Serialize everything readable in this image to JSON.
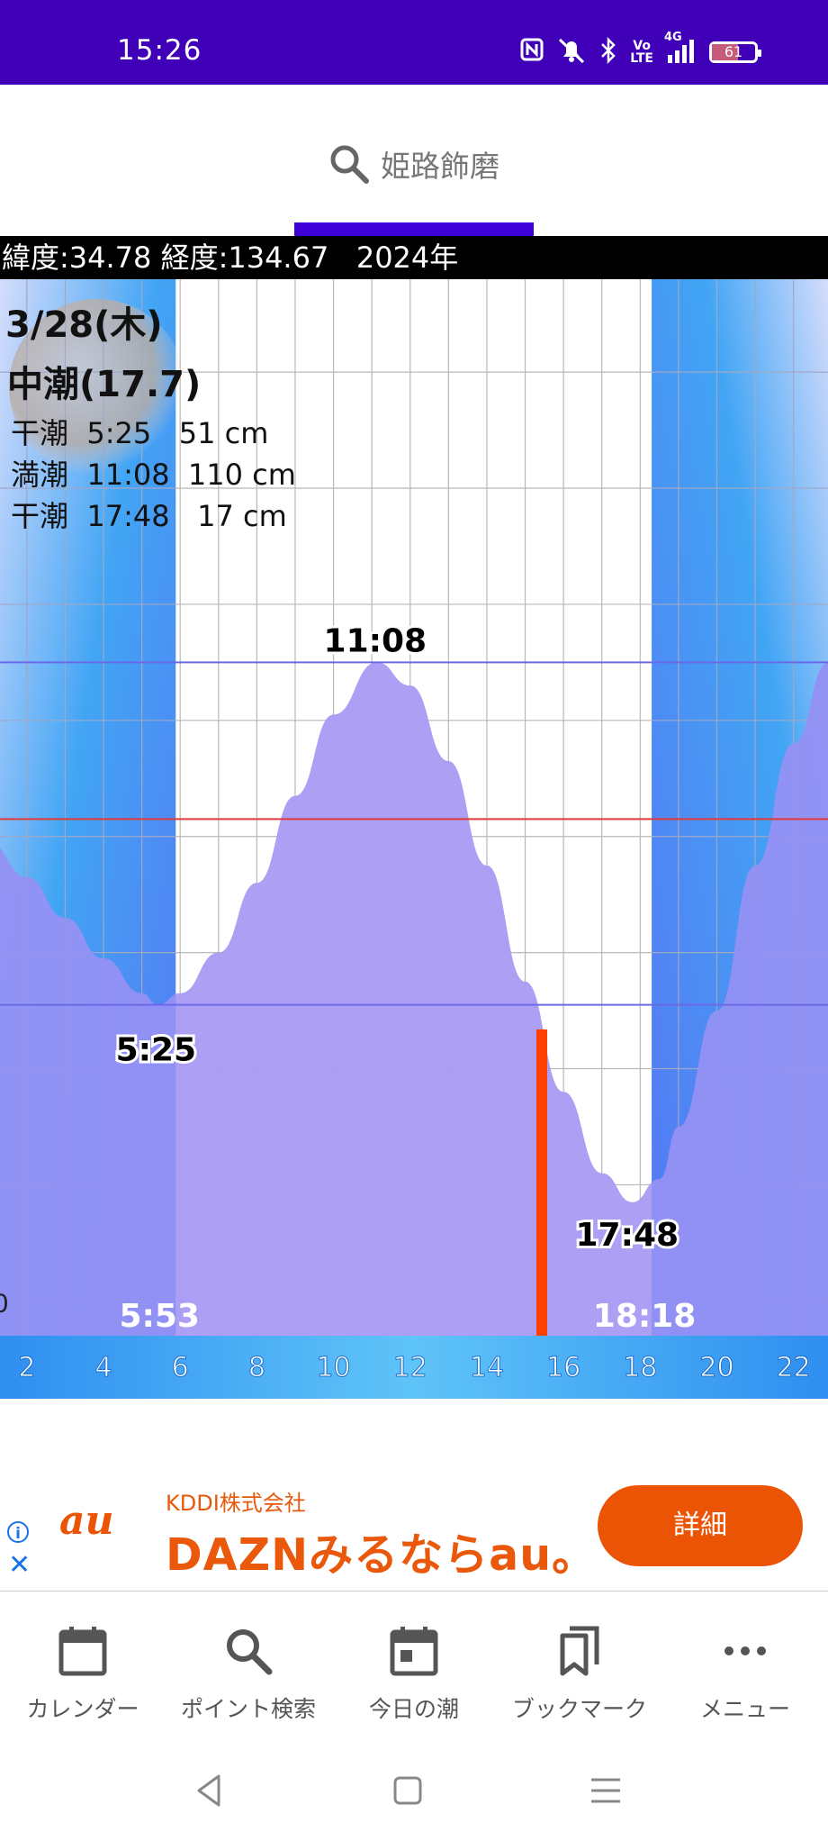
{
  "status_bar": {
    "time": "15:26",
    "icons": [
      "nfc-icon",
      "mute-icon",
      "bluetooth-icon",
      "volte-icon",
      "signal-icon"
    ],
    "volte_label": "Vo\nLTE",
    "network_label": "4G",
    "battery_level": "61",
    "background_color": "#4000b8"
  },
  "search": {
    "location": "姫路飾磨",
    "tab_indicator_color": "#4000d8"
  },
  "info_strip": {
    "text": "緯度:34.78 経度:134.67   2024年"
  },
  "chart_data": {
    "type": "area",
    "date": "3/28(木)",
    "tide_name": "中潮(17.7)",
    "tide_events": [
      {
        "kind": "干潮",
        "time": "5:25",
        "level": "51 cm"
      },
      {
        "kind": "満潮",
        "time": "11:08",
        "level": "110 cm"
      },
      {
        "kind": "干潮",
        "time": "17:48",
        "level": "17 cm"
      }
    ],
    "curve_labels": {
      "low_am": "5:25",
      "high": "11:08",
      "low_pm": "17:48"
    },
    "sunrise": "5:53",
    "sunset": "18:18",
    "partial_y_tick": "0",
    "current_time_marker": "15:26",
    "x_ticks": [
      "2",
      "4",
      "6",
      "8",
      "10",
      "12",
      "14",
      "16",
      "18",
      "20",
      "22"
    ],
    "curve_points": [
      {
        "x": 0,
        "y": 83
      },
      {
        "x": 1,
        "y": 79
      },
      {
        "x": 2,
        "y": 73
      },
      {
        "x": 3,
        "y": 66
      },
      {
        "x": 4,
        "y": 59
      },
      {
        "x": 5,
        "y": 53
      },
      {
        "x": 5.42,
        "y": 51
      },
      {
        "x": 6,
        "y": 53
      },
      {
        "x": 7,
        "y": 60
      },
      {
        "x": 8,
        "y": 72
      },
      {
        "x": 9,
        "y": 87
      },
      {
        "x": 10,
        "y": 101
      },
      {
        "x": 11.13,
        "y": 110
      },
      {
        "x": 12,
        "y": 106
      },
      {
        "x": 13,
        "y": 93
      },
      {
        "x": 14,
        "y": 75
      },
      {
        "x": 15,
        "y": 55
      },
      {
        "x": 16,
        "y": 36
      },
      {
        "x": 17,
        "y": 22
      },
      {
        "x": 17.8,
        "y": 17
      },
      {
        "x": 18.5,
        "y": 21
      },
      {
        "x": 19,
        "y": 30
      },
      {
        "x": 20,
        "y": 50
      },
      {
        "x": 21,
        "y": 75
      },
      {
        "x": 22,
        "y": 96
      },
      {
        "x": 22.9,
        "y": 110
      }
    ],
    "reference_lines_cm": [
      110,
      51
    ],
    "red_line_cm": 83,
    "xlim": [
      1.3,
      22.9
    ],
    "ylim": [
      -6,
      176
    ],
    "colors": {
      "night_sky": "#3ab4f5",
      "night_bottom": "#5876f5",
      "tide_fill": "#a99af3",
      "current_bar": "#ff4000",
      "red_line": "#e03a3a",
      "ref_line": "#6a6ae8",
      "axis_bar": "#2f8ef0"
    }
  },
  "ad": {
    "company": "KDDI株式会社",
    "headline": "DAZNみるならau。",
    "cta": "詳細",
    "logo_text": "au",
    "brand_color": "#ea5404"
  },
  "bottom_nav": {
    "items": [
      {
        "label": "カレンダー",
        "icon": "calendar-icon"
      },
      {
        "label": "ポイント検索",
        "icon": "search-icon"
      },
      {
        "label": "今日の潮",
        "icon": "today-calendar-icon"
      },
      {
        "label": "ブックマーク",
        "icon": "bookmarks-icon"
      },
      {
        "label": "メニュー",
        "icon": "more-icon"
      }
    ]
  },
  "system_nav": {
    "buttons": [
      "back-icon",
      "home-icon",
      "recents-icon"
    ]
  }
}
